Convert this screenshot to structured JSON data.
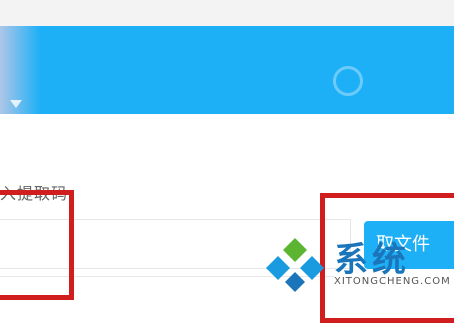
{
  "banner": {
    "color": "#1eb0f6"
  },
  "form": {
    "label": "入提取码:",
    "code_value": "",
    "submit_label": "取文件"
  },
  "annotations": {
    "highlight_color": "#d01d1d"
  },
  "watermark": {
    "brand": "系统",
    "url": "XITONGCHENG.COM"
  }
}
